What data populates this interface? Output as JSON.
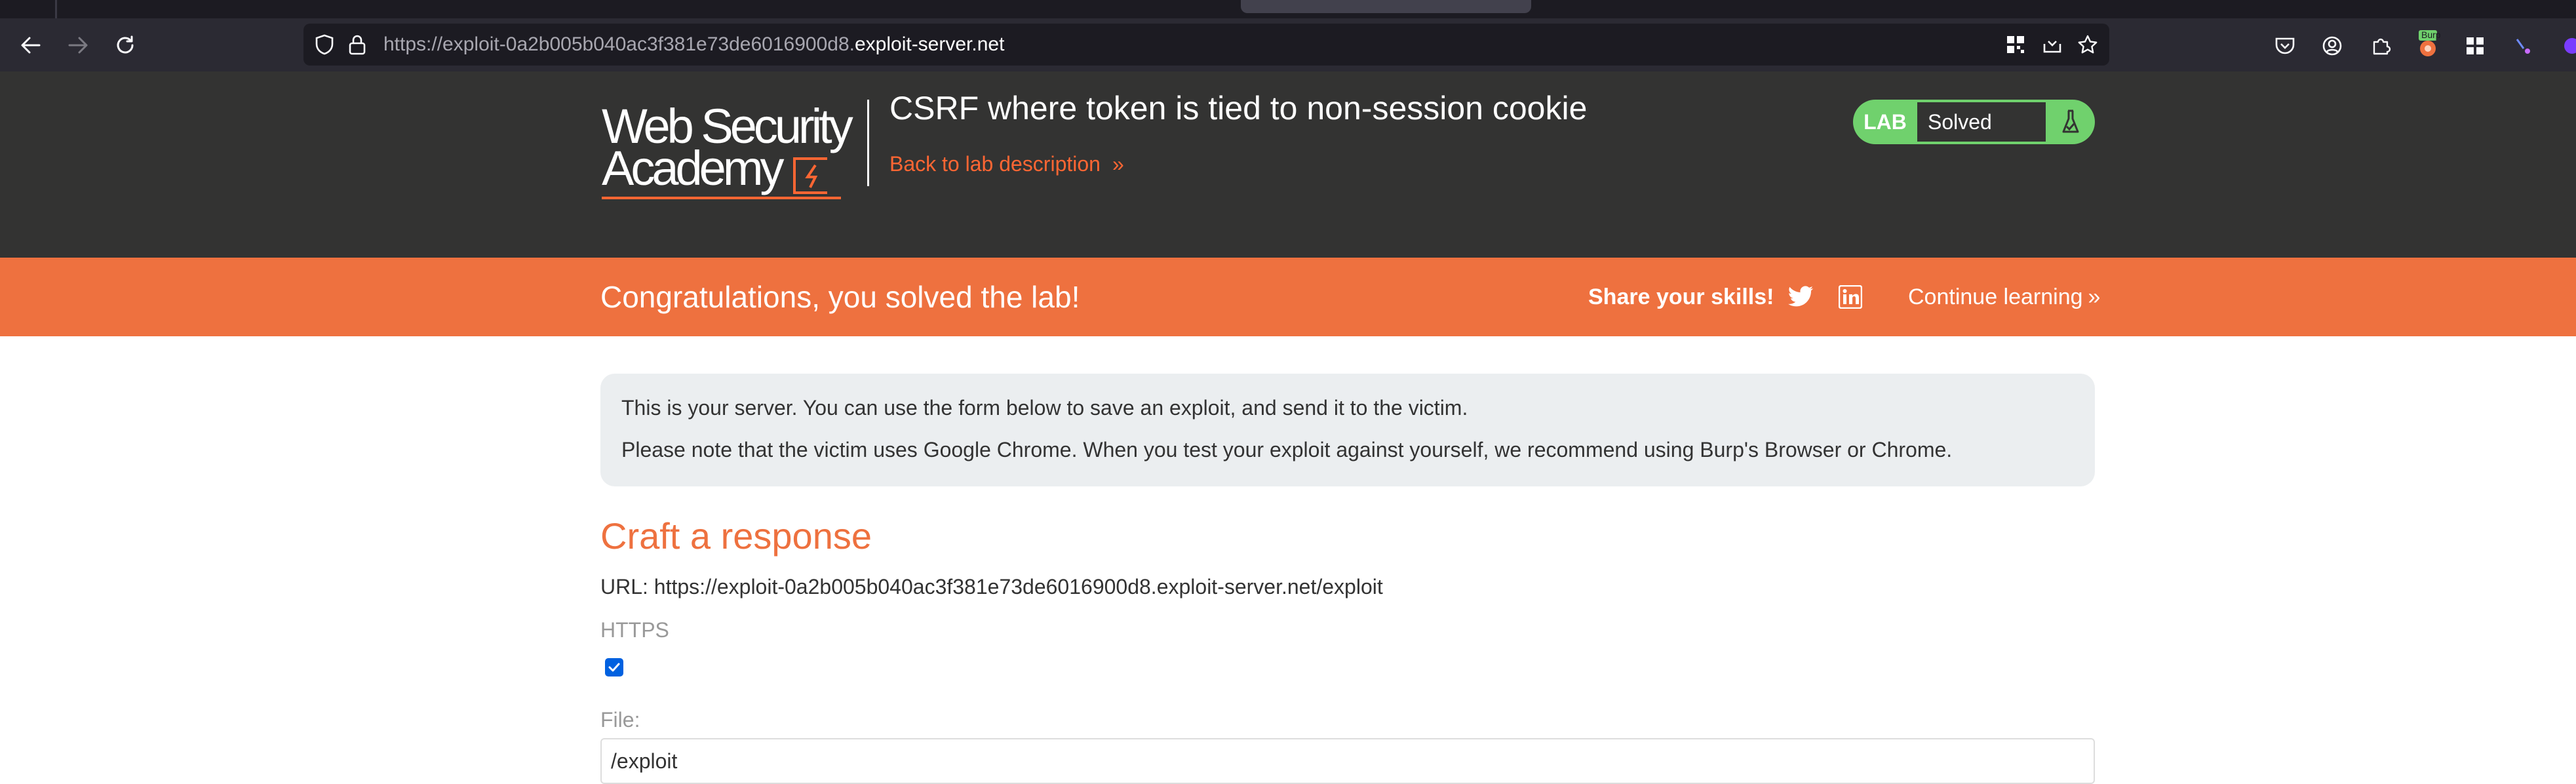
{
  "browser": {
    "url_prefix": "https://exploit-0a2b005b040ac3f381e73de6016900d8.",
    "url_host": "exploit-server.net",
    "icons": {
      "back": "arrow-left-icon",
      "forward": "arrow-right-icon",
      "reload": "reload-icon",
      "shield": "shield-icon",
      "lock": "lock-icon",
      "qr": "qr-code-icon",
      "pocket_save": "download-tray-icon",
      "bookmark": "star-icon",
      "pocket": "pocket-icon",
      "account": "account-icon",
      "extensions": "puzzle-icon",
      "burp_ext": "burp-extension-icon",
      "apps": "apps-grid-icon",
      "misc_ext": "extension-icon"
    },
    "burp_badge": "Burp"
  },
  "header": {
    "logo_line1": "Web Security",
    "logo_line2": "Academy",
    "lab_title": "CSRF where token is tied to non-session cookie",
    "back_link": "Back to lab description",
    "back_chevron": "»",
    "status_tag": "LAB",
    "status_value": "Solved"
  },
  "banner": {
    "message": "Congratulations, you solved the lab!",
    "share": "Share your skills!",
    "continue": "Continue learning",
    "continue_chevron": "»"
  },
  "info": {
    "line1": "This is your server. You can use the form below to save an exploit, and send it to the victim.",
    "line2": "Please note that the victim uses Google Chrome. When you test your exploit against yourself, we recommend using Burp's Browser or Chrome."
  },
  "form": {
    "heading": "Craft a response",
    "url_line": "URL: https://exploit-0a2b005b040ac3f381e73de6016900d8.exploit-server.net/exploit",
    "https_label": "HTTPS",
    "https_checked": true,
    "file_label": "File:",
    "file_value": "/exploit"
  },
  "colors": {
    "accent": "#ee713f",
    "solved_green": "#70d16d",
    "header_bg": "#333332"
  }
}
